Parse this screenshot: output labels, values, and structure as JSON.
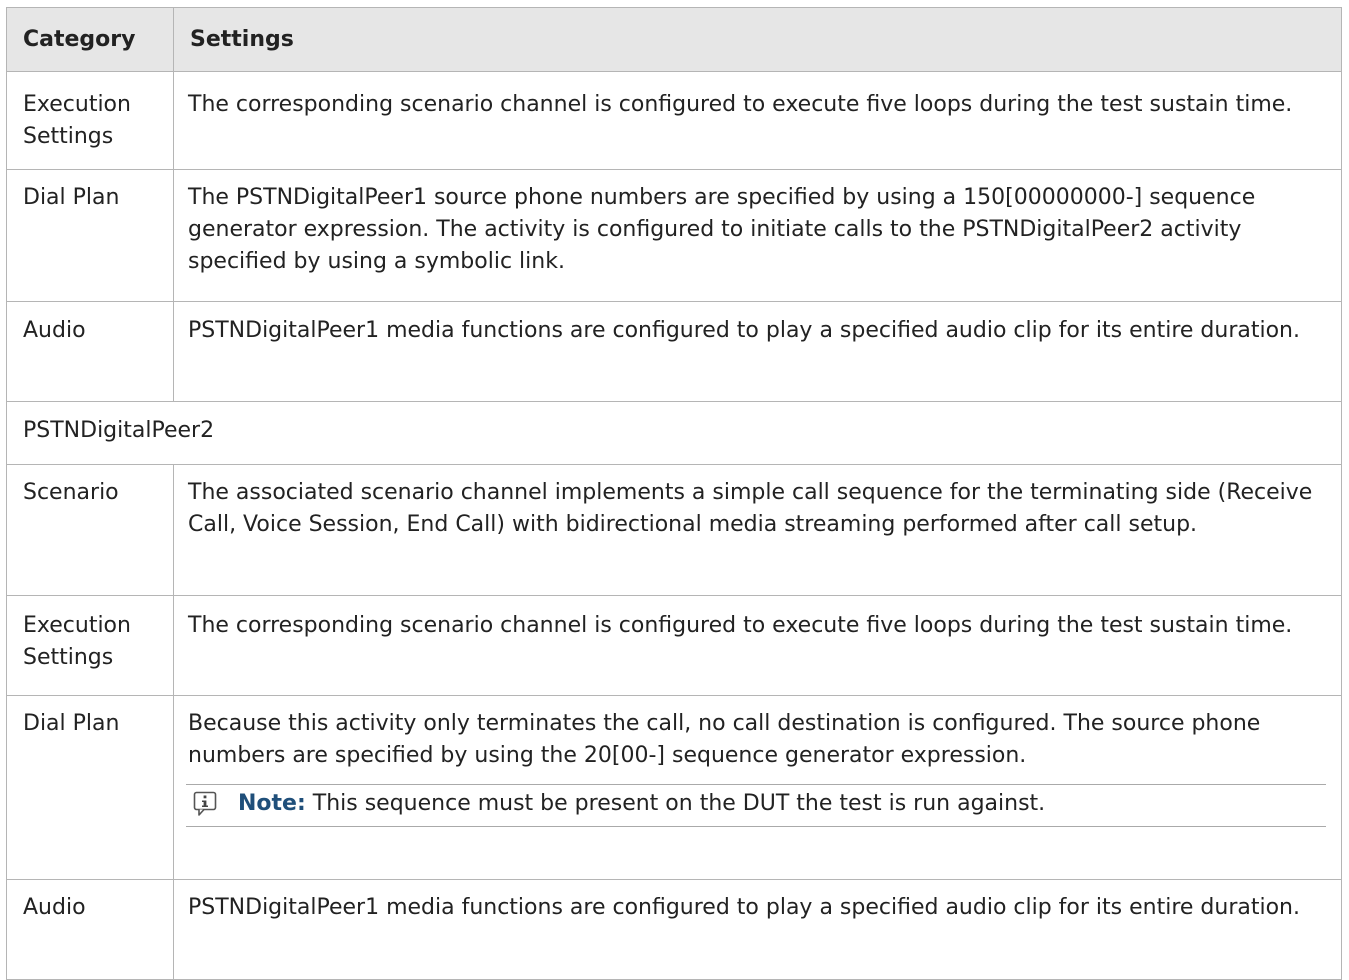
{
  "table": {
    "headers": {
      "category": "Category",
      "settings": "Settings"
    },
    "rows": [
      {
        "category": "Execution Settings",
        "settings": "The corresponding scenario channel is configured to execute five loops during the test sustain time."
      },
      {
        "category": "Dial Plan",
        "settings": "The PSTNDigitalPeer1 source phone numbers are specified by using a 150[00000000-] sequence generator expression. The activity is configured to initiate calls to the PSTNDigitalPeer2 activity specified by using a symbolic link."
      },
      {
        "category": "Audio",
        "settings": "PSTNDigitalPeer1 media functions are configured to play a specified audio clip for its entire duration."
      }
    ],
    "section_heading": "PSTNDigitalPeer2",
    "rows2": [
      {
        "category": "Scenario",
        "settings": "The associated scenario channel implements a simple call sequence for the terminating side (Receive Call, Voice Session, End Call) with bidirectional media streaming performed after call setup."
      },
      {
        "category": "Execution Settings",
        "settings": "The corresponding scenario channel is configured to execute five loops during the test sustain time."
      },
      {
        "category": "Dial Plan",
        "settings": "Because this activity only terminates the call, no call destination is configured. The source phone numbers are specified by using the 20[00-] sequence generator expression.",
        "note": {
          "icon": "info-icon",
          "label": "Note:",
          "text": "This sequence must be present on the DUT the test is run against."
        }
      },
      {
        "category": "Audio",
        "settings": "PSTNDigitalPeer1 media functions are configured to play a specified audio clip for its entire duration."
      }
    ]
  },
  "colors": {
    "header_bg": "#e6e6e6",
    "border": "#b5b5b5",
    "note_label": "#1f4f7a"
  }
}
